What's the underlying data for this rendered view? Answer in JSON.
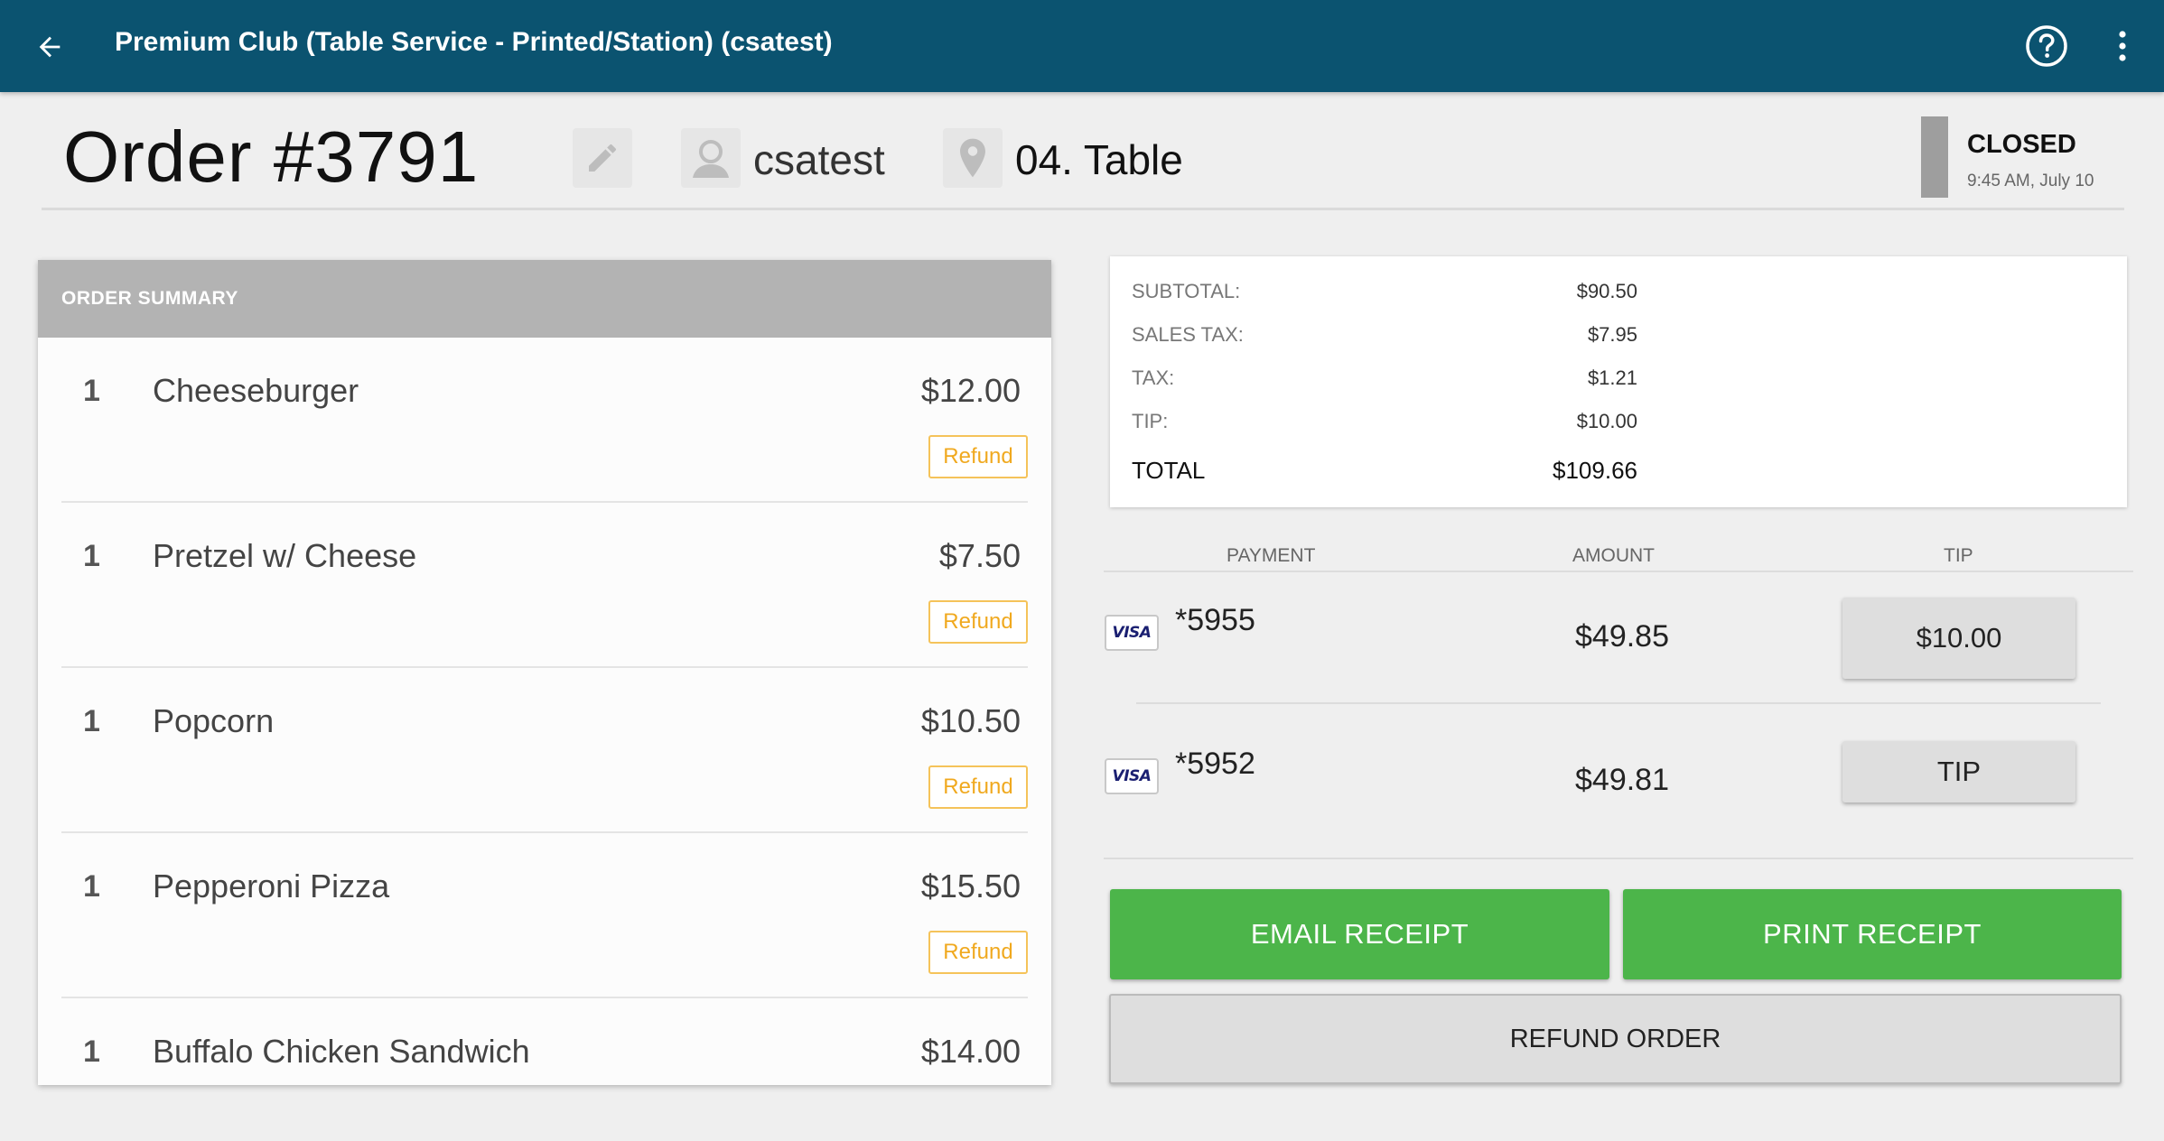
{
  "app_bar": {
    "title": "Premium Club (Table Service - Printed/Station) (csatest)",
    "back_icon": "arrow-left",
    "help_icon": "question-circle",
    "more_icon": "vertical-ellipsis"
  },
  "order": {
    "title": "Order #3791",
    "user": "csatest",
    "location": "04. Table",
    "status": "CLOSED",
    "status_time": "9:45 AM, July 10"
  },
  "summary": {
    "header": "ORDER SUMMARY",
    "refund_label": "Refund",
    "items": [
      {
        "qty": "1",
        "name": "Cheeseburger",
        "price": "$12.00"
      },
      {
        "qty": "1",
        "name": "Pretzel w/ Cheese",
        "price": "$7.50"
      },
      {
        "qty": "1",
        "name": "Popcorn",
        "price": "$10.50"
      },
      {
        "qty": "1",
        "name": "Pepperoni Pizza",
        "price": "$15.50"
      },
      {
        "qty": "1",
        "name": "Buffalo Chicken Sandwich",
        "price": "$14.00"
      }
    ]
  },
  "totals": {
    "subtotal": {
      "label": "SUBTOTAL:",
      "value": "$90.50"
    },
    "sales_tax": {
      "label": "SALES TAX:",
      "value": "$7.95"
    },
    "tax": {
      "label": "TAX:",
      "value": "$1.21"
    },
    "tip": {
      "label": "TIP:",
      "value": "$10.00"
    },
    "total": {
      "label": "TOTAL",
      "value": "$109.66"
    }
  },
  "payments": {
    "headers": {
      "payment": "PAYMENT",
      "amount": "AMOUNT",
      "tip": "TIP"
    },
    "rows": [
      {
        "card_brand": "VISA",
        "card": "*5955",
        "amount": "$49.85",
        "tip": "$10.00"
      },
      {
        "card_brand": "VISA",
        "card": "*5952",
        "amount": "$49.81",
        "tip": "TIP"
      }
    ]
  },
  "actions": {
    "email_receipt": "EMAIL RECEIPT",
    "print_receipt": "PRINT RECEIPT",
    "refund_order": "REFUND ORDER"
  },
  "colors": {
    "app_bar": "#0b5370",
    "green_button": "#4cb54a",
    "refund_accent": "#f0a91f",
    "status_closed": "#9e9e9e"
  }
}
